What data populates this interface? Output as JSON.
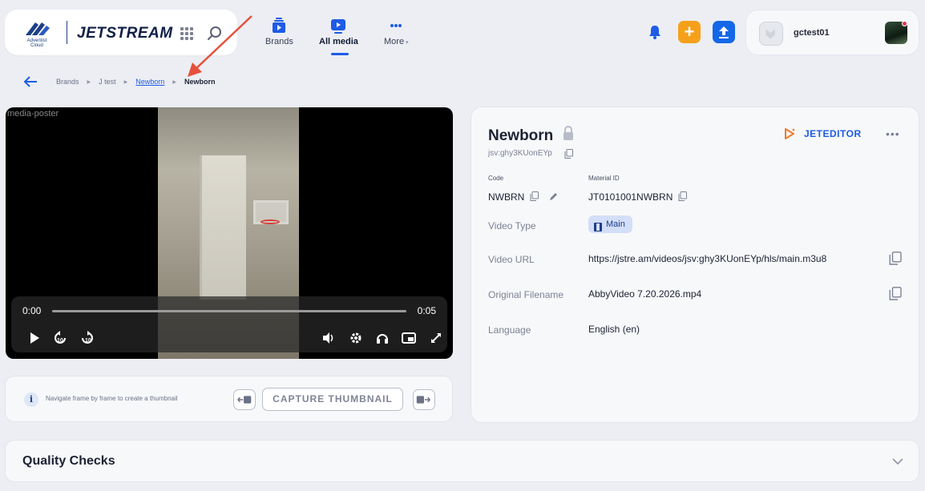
{
  "app": {
    "logo_text": "JETSTREAM",
    "logo_subtext": "Adventist Cloud"
  },
  "nav": {
    "tabs": [
      {
        "label": "Brands",
        "icon": "brands-icon"
      },
      {
        "label": "All media",
        "icon": "media-icon",
        "active": true
      },
      {
        "label": "More",
        "icon": "more-icon"
      }
    ],
    "user_name": "gctest01"
  },
  "breadcrumb": {
    "items": [
      "Brands",
      "J test",
      "Newborn",
      "Newborn"
    ]
  },
  "player": {
    "poster_alt": "media-poster",
    "current_time": "0:00",
    "duration": "0:05",
    "progress": 0
  },
  "thumbnail": {
    "hint": "Navigate frame by frame to create a thumbnail",
    "capture_label": "CAPTURE THUMBNAIL"
  },
  "details": {
    "title": "Newborn",
    "jsv_id": "jsv:ghy3KUonEYp",
    "jeteditor_label": "JETEDITOR",
    "code_label": "Code",
    "code_value": "NWBRN",
    "material_label": "Material ID",
    "material_value": "JT0101001NWBRN",
    "video_type_label": "Video Type",
    "video_type_value": "Main",
    "video_url_label": "Video URL",
    "video_url_value": "https://jstre.am/videos/jsv:ghy3KUonEYp/hls/main.m3u8",
    "filename_label": "Original Filename",
    "filename_value": "AbbyVideo 7.20.2026.mp4",
    "language_label": "Language",
    "language_value": "English (en)"
  },
  "quality_checks": {
    "title": "Quality Checks"
  },
  "colors": {
    "accent": "#1e5be6",
    "plus_button": "#f6a01a",
    "upload_button": "#1467e8"
  }
}
